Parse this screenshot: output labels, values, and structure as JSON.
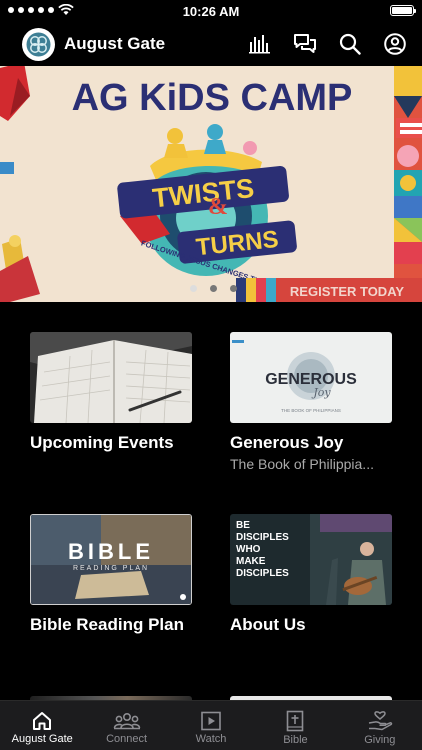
{
  "status": {
    "time": "10:26 AM"
  },
  "header": {
    "title": "August Gate"
  },
  "banner": {
    "headline": "AG KiDS CAMP",
    "art_top": "TWISTS",
    "art_amp": "&",
    "art_bottom": "TURNS",
    "art_caption": "FOLLOWING JESUS CHANGES THE GAME PSALM 25:4",
    "cta": "REGISTER TODAY",
    "slides_count": 3,
    "active_slide": 0
  },
  "cards": [
    {
      "title": "Upcoming Events",
      "subtitle": ""
    },
    {
      "title": "Generous Joy",
      "subtitle": "The Book of Philippia...",
      "thumb_title": "GENEROUS",
      "thumb_script": "Joy",
      "thumb_caption": "THE BOOK OF PHILIPPIANS"
    },
    {
      "title": "Bible Reading Plan",
      "subtitle": "",
      "thumb_title": "BIBLE",
      "thumb_caption": "READING PLAN"
    },
    {
      "title": "About Us",
      "subtitle": "",
      "thumb_lines": [
        "BE",
        "DISCIPLES",
        "WHO",
        "MAKE",
        "DISCIPLES"
      ]
    }
  ],
  "tabs": [
    {
      "label": "August Gate",
      "icon": "home-icon",
      "active": true
    },
    {
      "label": "Connect",
      "icon": "people-icon",
      "active": false
    },
    {
      "label": "Watch",
      "icon": "play-icon",
      "active": false
    },
    {
      "label": "Bible",
      "icon": "bible-icon",
      "active": false
    },
    {
      "label": "Giving",
      "icon": "giving-icon",
      "active": false
    }
  ],
  "colors": {
    "accent": "#ffffff",
    "tab_inactive": "#8e8e93",
    "banner_bg": "#f2e3d0",
    "headline": "#2b2f74",
    "cta_bg": "#d6453d"
  }
}
